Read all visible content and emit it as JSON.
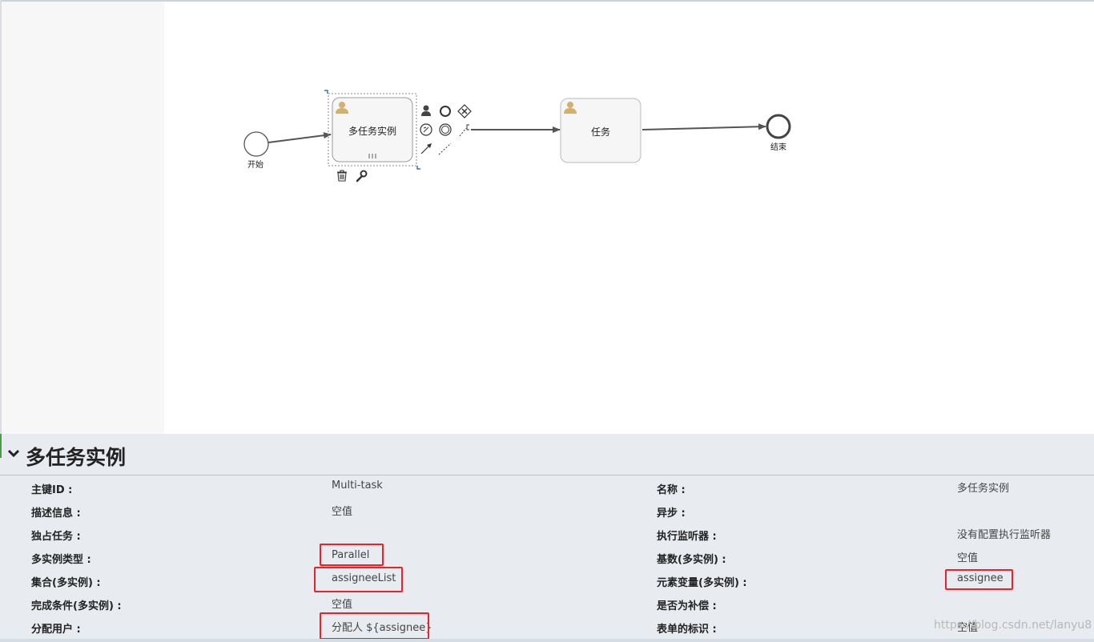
{
  "diagram": {
    "start_label": "开始",
    "task1_label": "多任务实例",
    "task2_label": "任务",
    "end_label": "结束"
  },
  "properties": {
    "title": "多任务实例",
    "rows": [
      {
        "label_left": "主键ID :",
        "value_left": "Multi-task",
        "label_right": "名称 :",
        "value_right": "多任务实例"
      },
      {
        "label_left": "描述信息 :",
        "value_left": "空值",
        "label_right": "异步 :",
        "value_right": ""
      },
      {
        "label_left": "独占任务 :",
        "value_left": "",
        "label_right": "执行监听器 :",
        "value_right": "没有配置执行监听器"
      },
      {
        "label_left": "多实例类型 :",
        "value_left": "Parallel",
        "label_right": "基数(多实例) :",
        "value_right": "空值"
      },
      {
        "label_left": "集合(多实例) :",
        "value_left": "assigneeList",
        "label_right": "元素变量(多实例) :",
        "value_right": "assignee"
      },
      {
        "label_left": "完成条件(多实例) :",
        "value_left": "空值",
        "label_right": "是否为补偿 :",
        "value_right": ""
      },
      {
        "label_left": "分配用户 :",
        "value_left": "分配人 ${assignee}",
        "label_right": "表单的标识 :",
        "value_right": "空值"
      }
    ]
  },
  "watermark": "https://blog.csdn.net/lanyu8",
  "colors": {
    "highlight": "#e8242a",
    "panel_bg": "#e8ecf1",
    "user_icon": "#d4b06a"
  }
}
